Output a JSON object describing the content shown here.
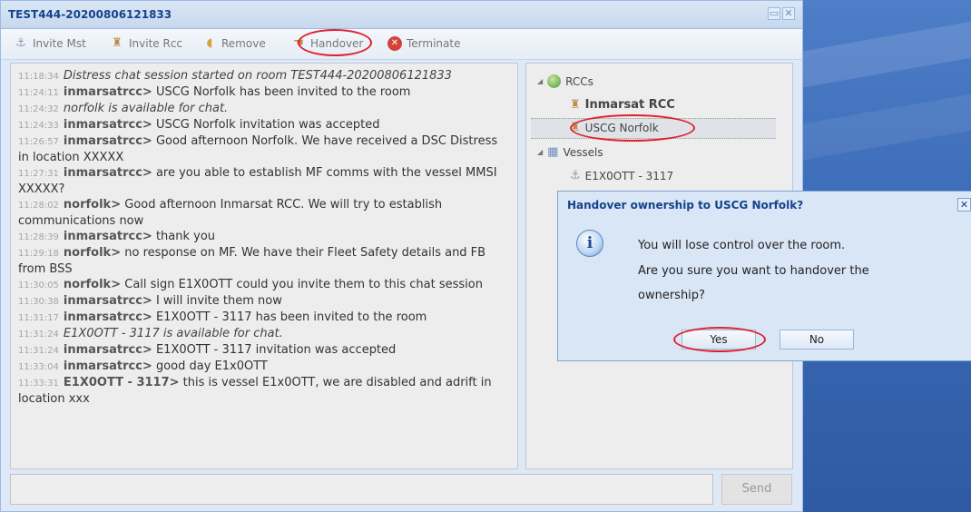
{
  "window": {
    "title": "TEST444-20200806121833"
  },
  "toolbar": {
    "invite_mst": "Invite Mst",
    "invite_rcc": "Invite Rcc",
    "remove": "Remove",
    "handover": "Handover",
    "terminate": "Terminate"
  },
  "chat": [
    {
      "ts": "11:18:34",
      "user": "",
      "text": "Distress chat session started on room TEST444-20200806121833",
      "italic": true
    },
    {
      "ts": "11:24:11",
      "user": "inmarsatrcc>",
      "text": "USCG Norfolk has been invited to the room",
      "italic": false
    },
    {
      "ts": "11:24:32",
      "user": "",
      "text": "norfolk is available for chat.",
      "italic": true
    },
    {
      "ts": "11:24:33",
      "user": "inmarsatrcc>",
      "text": "USCG Norfolk invitation was accepted",
      "italic": false
    },
    {
      "ts": "11:26:57",
      "user": "inmarsatrcc>",
      "text": "Good afternoon Norfolk. We have received a DSC Distress in location XXXXX",
      "italic": false
    },
    {
      "ts": "11:27:31",
      "user": "inmarsatrcc>",
      "text": "are you able to establish MF comms with the vessel MMSI XXXXX?",
      "italic": false
    },
    {
      "ts": "11:28:02",
      "user": "norfolk>",
      "text": "Good afternoon Inmarsat RCC. We will try to establish communications now",
      "italic": false
    },
    {
      "ts": "11:28:39",
      "user": "inmarsatrcc>",
      "text": "thank you",
      "italic": false
    },
    {
      "ts": "11:29:18",
      "user": "norfolk>",
      "text": "no response on MF. We have their Fleet Safety details and FB from BSS",
      "italic": false
    },
    {
      "ts": "11:30:05",
      "user": "norfolk>",
      "text": "Call sign E1X0OTT could you invite them to this chat session",
      "italic": false
    },
    {
      "ts": "11:30:38",
      "user": "inmarsatrcc>",
      "text": "I will invite them now",
      "italic": false
    },
    {
      "ts": "11:31:17",
      "user": "inmarsatrcc>",
      "text": "E1X0OTT - 3117 has been invited to the room",
      "italic": false
    },
    {
      "ts": "11:31:24",
      "user": "",
      "text": "E1X0OTT - 3117 is available for chat.",
      "italic": true
    },
    {
      "ts": "11:31:24",
      "user": "inmarsatrcc>",
      "text": "E1X0OTT - 3117 invitation was accepted",
      "italic": false
    },
    {
      "ts": "11:33:04",
      "user": "inmarsatrcc>",
      "text": "good day E1x0OTT",
      "italic": false
    },
    {
      "ts": "11:33:31",
      "user": "E1X0OTT - 3117>",
      "text": "this is vessel E1x0OTT, we are disabled and adrift in location xxx",
      "italic": false
    }
  ],
  "tree": {
    "rccs_label": "RCCs",
    "rcc_inmarsat": "Inmarsat RCC",
    "rcc_uscg": "USCG Norfolk",
    "vessels_label": "Vessels",
    "vessel_1": "E1X0OTT - 3117"
  },
  "input": {
    "send_label": "Send"
  },
  "dialog": {
    "title": "Handover ownership to USCG Norfolk?",
    "line1": "You will lose control over the room.",
    "line2": "Are you sure you want to handover the",
    "line3": "ownership?",
    "yes": "Yes",
    "no": "No"
  },
  "colors": {
    "highlight": "#e0202c",
    "title": "#15428b"
  }
}
